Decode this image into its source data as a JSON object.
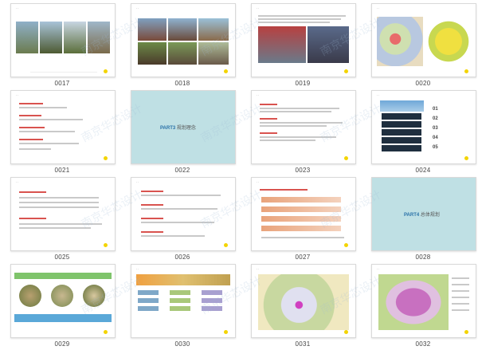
{
  "slides": [
    {
      "id": "s17",
      "number": "0017"
    },
    {
      "id": "s18",
      "number": "0018"
    },
    {
      "id": "s19",
      "number": "0019"
    },
    {
      "id": "s20",
      "number": "0020"
    },
    {
      "id": "s21",
      "number": "0021"
    },
    {
      "id": "s22",
      "number": "0022"
    },
    {
      "id": "s23",
      "number": "0023"
    },
    {
      "id": "s24",
      "number": "0024"
    },
    {
      "id": "s25",
      "number": "0025"
    },
    {
      "id": "s26",
      "number": "0026"
    },
    {
      "id": "s27",
      "number": "0027"
    },
    {
      "id": "s28",
      "number": "0028"
    },
    {
      "id": "s29",
      "number": "0029"
    },
    {
      "id": "s30",
      "number": "0030"
    },
    {
      "id": "s31",
      "number": "0031"
    },
    {
      "id": "s32",
      "number": "0032"
    }
  ],
  "slide22": {
    "part": "PART3",
    "title": "规划理念"
  },
  "slide28": {
    "part": "PART4",
    "title": "总体规划"
  },
  "slide24": {
    "items": [
      "01",
      "02",
      "03",
      "04",
      "05"
    ]
  },
  "watermark": "南京华芯设计",
  "colors": {
    "accent_yellow": "#f3d400",
    "teal": "#bfe0e4",
    "red": "#d9534f",
    "blue": "#2a72a8"
  }
}
